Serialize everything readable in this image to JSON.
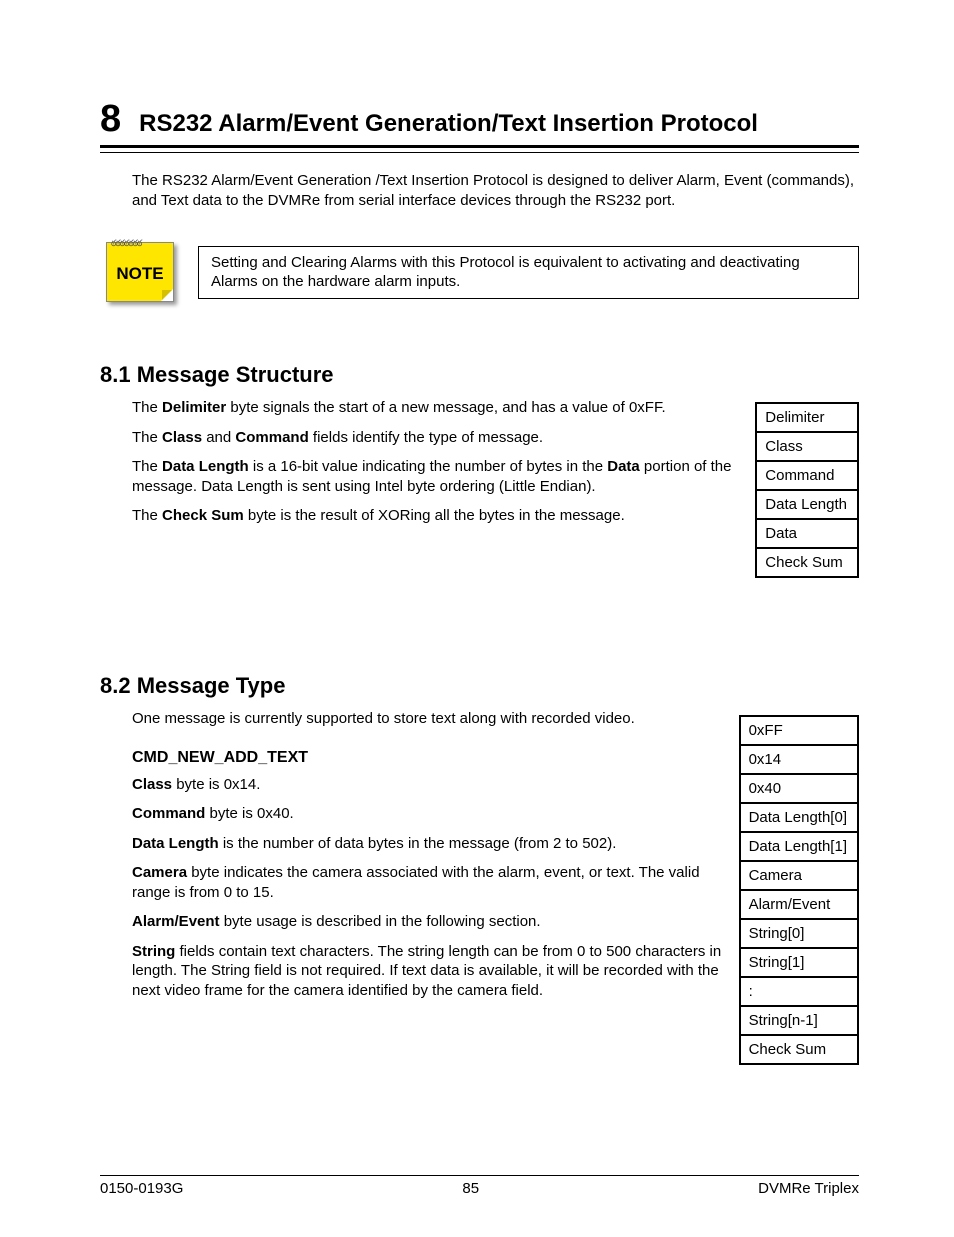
{
  "chapter": {
    "number": "8",
    "title": "RS232 Alarm/Event Generation/Text Insertion Protocol"
  },
  "intro": "The RS232 Alarm/Event Generation /Text Insertion Protocol is designed to deliver Alarm, Event (commands), and Text data to the DVMRe from serial interface devices through the RS232 port.",
  "note": {
    "label": "NOTE",
    "text": "Setting and Clearing Alarms with this Protocol is equivalent to activating and deactivating Alarms on the hardware alarm inputs."
  },
  "s81": {
    "heading": "8.1 Message Structure",
    "p1a": "The ",
    "p1b": "Delimiter",
    "p1c": " byte signals the start of a new message, and has a value of 0xFF.",
    "p2a": "The ",
    "p2b": "Class",
    "p2c": " and ",
    "p2d": "Command",
    "p2e": " fields identify the type of message.",
    "p3a": "The ",
    "p3b": "Data Length",
    "p3c": " is a 16-bit value indicating the number of bytes in the ",
    "p3d": "Data",
    "p3e": " portion of the message.  Data Length is sent using Intel byte ordering (Little Endian).",
    "p4a": "The ",
    "p4b": "Check Sum",
    "p4c": " byte is the result of XORing all the bytes in the message.",
    "table": [
      "Delimiter",
      "Class",
      "Command",
      "Data Length",
      "Data",
      "Check Sum"
    ]
  },
  "s82": {
    "heading": "8.2 Message Type",
    "p1": "One message is currently supported to store text along with recorded video.",
    "sub": "CMD_NEW_ADD_TEXT",
    "p2a": "Class",
    "p2b": " byte is 0x14.",
    "p3a": "Command",
    "p3b": " byte is 0x40.",
    "p4a": "Data Length",
    "p4b": " is the number of data bytes in the message (from 2 to 502).",
    "p5a": "Camera",
    "p5b": " byte indicates the camera associated with the alarm, event, or text.  The valid range is from 0 to 15.",
    "p6a": "Alarm/Event",
    "p6b": " byte usage is described in the following section.",
    "p7a": "String",
    "p7b": " fields contain text characters.  The string length can be from 0 to 500 characters in length. The String field is not required. If text data is available, it will be recorded with the next video frame for the camera identified by the camera field.",
    "table": [
      "0xFF",
      "0x14",
      "0x40",
      "Data Length[0]",
      "Data Length[1]",
      "Camera",
      "Alarm/Event",
      "String[0]",
      "String[1]",
      ":",
      "String[n-1]",
      "Check Sum"
    ]
  },
  "footer": {
    "left": "0150-0193G",
    "center": "85",
    "right": "DVMRe Triplex"
  }
}
